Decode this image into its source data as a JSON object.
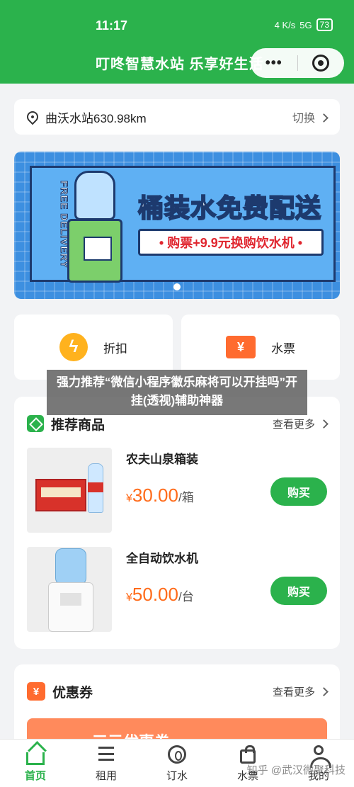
{
  "status": {
    "time": "11:17",
    "network": "4 K/s",
    "signal": "5G",
    "battery": "73"
  },
  "nav": {
    "title": "叮咚智慧水站 乐享好生活",
    "more": "•••"
  },
  "location": {
    "station": "曲沃水站630.98km",
    "switch_label": "切换"
  },
  "banner": {
    "side_text": "FREE DELIVERY",
    "title": "桶装水免费配送",
    "subtitle": "• 购票+9.9元换购饮水机 •"
  },
  "quick": [
    {
      "label": "折扣",
      "icon": "lightning-icon"
    },
    {
      "label": "水票",
      "icon": "ticket-icon",
      "symbol": "¥"
    }
  ],
  "overlay_text": "强力推荐“微信小程序徽乐麻将可以开挂吗”开挂(透视)辅助神器",
  "recommend": {
    "title": "推荐商品",
    "more": "查看更多",
    "products": [
      {
        "name": "农夫山泉箱装",
        "currency": "¥",
        "price": "30.00",
        "unit": "/箱",
        "buy": "购买"
      },
      {
        "name": "全自动饮水机",
        "currency": "¥",
        "price": "50.00",
        "unit": "/台",
        "buy": "购买"
      }
    ]
  },
  "coupon": {
    "title": "优惠券",
    "more": "查看更多",
    "strip_text": "三元优惠券",
    "icon_symbol": "¥"
  },
  "tabs": [
    {
      "label": "首页",
      "active": true
    },
    {
      "label": "租用"
    },
    {
      "label": "订水"
    },
    {
      "label": "水票"
    },
    {
      "label": "我的"
    }
  ],
  "watermark": "知乎 @武汉微聚科技",
  "colors": {
    "brand": "#2bb24c",
    "price": "#ff6b1a",
    "accent": "#ff6b2f"
  }
}
